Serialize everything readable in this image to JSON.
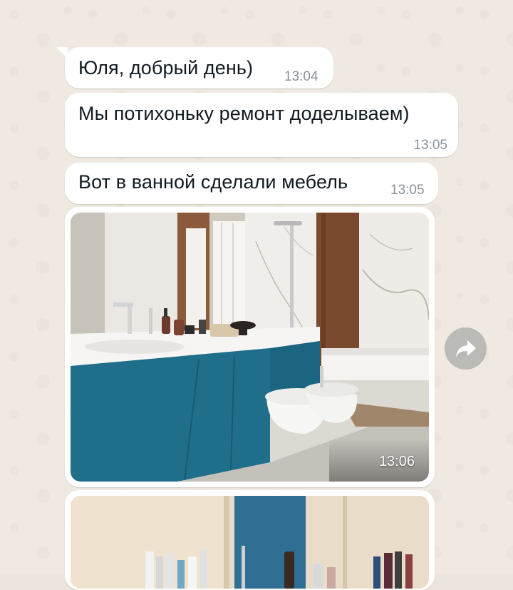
{
  "chat": {
    "messages": [
      {
        "text": "Юля, добрый день)",
        "time": "13:04"
      },
      {
        "text": "Мы потихоньку ремонт доделываем)",
        "time": "13:05"
      },
      {
        "text": "Вот в ванной сделали мебель",
        "time": "13:05"
      }
    ],
    "photos": [
      {
        "time": "13:06",
        "alt": "bathroom-photo"
      },
      {
        "alt": "bathroom-shelf-photo"
      }
    ],
    "forward_icon": "forward-arrow-icon"
  },
  "colors": {
    "bubble": "#ffffff",
    "wallpaper": "#efe9e1",
    "time_text": "#8a9399",
    "cabinet_blue": "#1f6f8b"
  }
}
